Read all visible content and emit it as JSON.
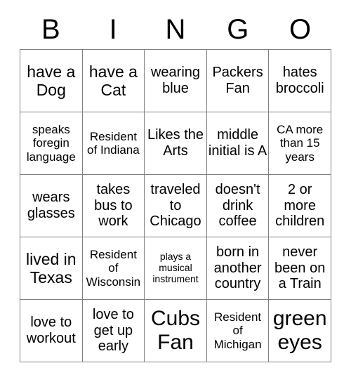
{
  "card": {
    "header_letters": [
      "B",
      "I",
      "N",
      "G",
      "O"
    ],
    "columns": 5,
    "rows": 5,
    "border_color": "#808080",
    "text_color": "#000000",
    "background_color": "#ffffff",
    "cells": [
      {
        "text": "have a Dog",
        "size": "lg"
      },
      {
        "text": "have a Cat",
        "size": "lg"
      },
      {
        "text": "wearing blue",
        "size": "md"
      },
      {
        "text": "Packers Fan",
        "size": "md"
      },
      {
        "text": "hates broccoli",
        "size": "md"
      },
      {
        "text": "speaks foregin language",
        "size": "sm"
      },
      {
        "text": "Resident of Indiana",
        "size": "sm"
      },
      {
        "text": "Likes the Arts",
        "size": "md"
      },
      {
        "text": "middle initial is A",
        "size": "md"
      },
      {
        "text": "CA more than 15 years",
        "size": "sm"
      },
      {
        "text": "wears glasses",
        "size": "md"
      },
      {
        "text": "takes bus to work",
        "size": "md"
      },
      {
        "text": "traveled to Chicago",
        "size": "md"
      },
      {
        "text": "doesn't drink coffee",
        "size": "md"
      },
      {
        "text": "2 or more children",
        "size": "md"
      },
      {
        "text": "lived in Texas",
        "size": "lg"
      },
      {
        "text": "Resident of Wisconsin",
        "size": "sm"
      },
      {
        "text": "plays a musical instrument",
        "size": "xs"
      },
      {
        "text": "born in another country",
        "size": "md"
      },
      {
        "text": "never been on a Train",
        "size": "md"
      },
      {
        "text": "love to workout",
        "size": "md"
      },
      {
        "text": "love to get up early",
        "size": "md"
      },
      {
        "text": "Cubs Fan",
        "size": "xl"
      },
      {
        "text": "Resident of Michigan",
        "size": "sm"
      },
      {
        "text": "green eyes",
        "size": "xl"
      }
    ]
  }
}
